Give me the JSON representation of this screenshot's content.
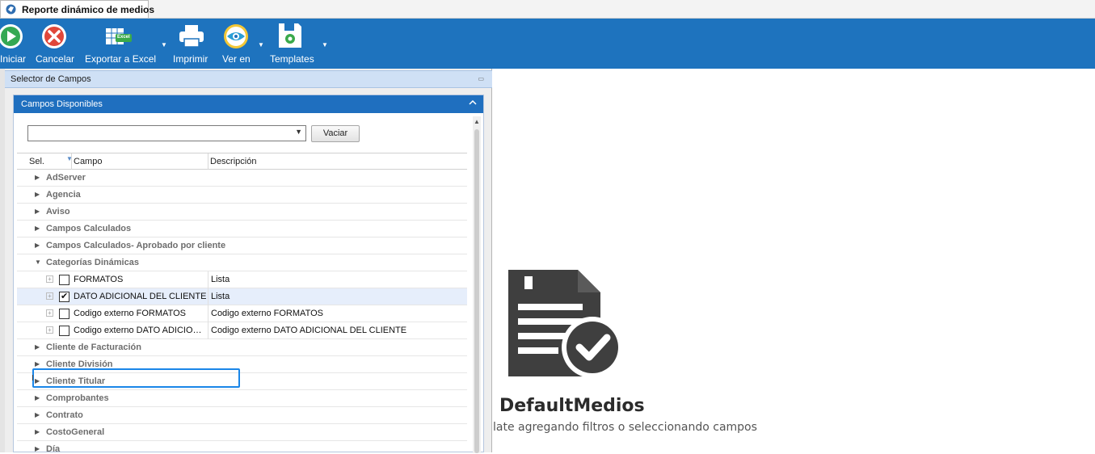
{
  "tab": {
    "title": "Reporte dinámico de medios"
  },
  "ribbon": {
    "iniciar": "Iniciar",
    "cancelar": "Cancelar",
    "exportar_excel": "Exportar a Excel",
    "excel_badge": "Excel",
    "imprimir": "Imprimir",
    "ver_en": "Ver en",
    "templates": "Templates"
  },
  "selector": {
    "title": "Selector de Campos",
    "group_title": "Campos Disponibles",
    "combo_value": "",
    "vaciar_label": "Vaciar",
    "columns": {
      "sel": "Sel.",
      "campo": "Campo",
      "descripcion": "Descripción"
    },
    "groups": [
      "AdServer",
      "Agencia",
      "Aviso",
      "Campos Calculados",
      "Campos Calculados- Aprobado por cliente",
      "Categorías Dinámicas",
      "Cliente de Facturación",
      "Cliente División",
      "Cliente Titular",
      "Comprobantes",
      "Contrato",
      "CostoGeneral",
      "Día"
    ],
    "children": [
      {
        "campo": "FORMATOS",
        "descripcion": "Lista",
        "checked": false
      },
      {
        "campo": "DATO ADICIONAL DEL CLIENTE",
        "descripcion": "Lista",
        "checked": true
      },
      {
        "campo": "Codigo externo FORMATOS",
        "descripcion": "Codigo externo FORMATOS",
        "checked": false
      },
      {
        "campo": "Codigo externo DATO ADICIO…",
        "descripcion": "Codigo externo DATO ADICIONAL DEL CLIENTE",
        "checked": false
      }
    ]
  },
  "template": {
    "name": "DefaultMedios",
    "hint": "late agregando filtros o seleccionando campos"
  },
  "colors": {
    "ribbon": "#1e73be",
    "group_header": "#1f6fbf",
    "highlight": "#1a86e8"
  }
}
